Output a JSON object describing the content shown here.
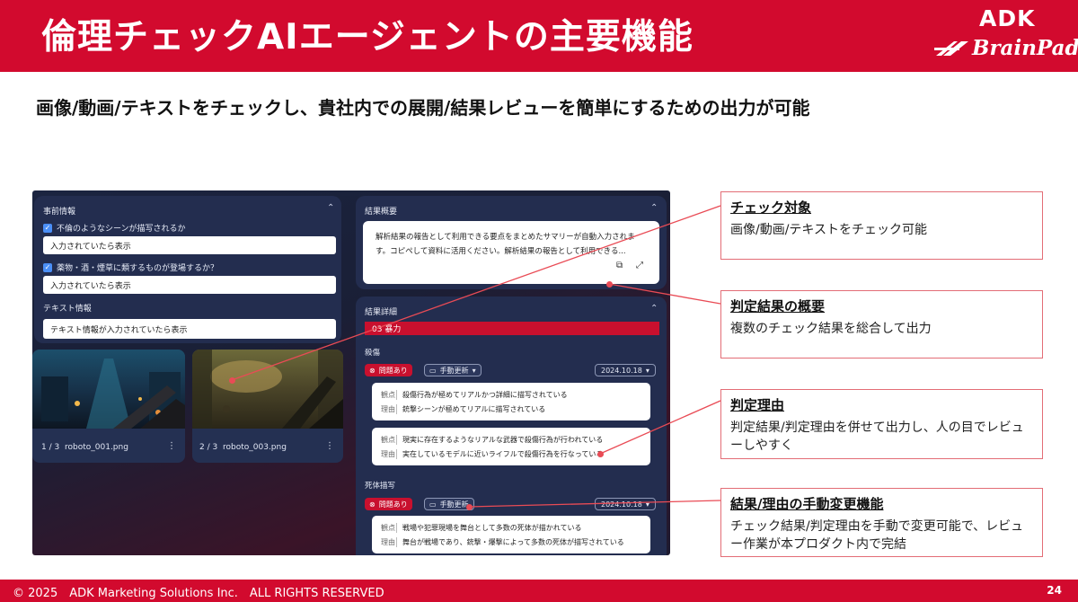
{
  "header": {
    "title": "倫理チェックAIエージェントの主要機能",
    "logo_adk": "ADK",
    "logo_brainpad": "BrainPad"
  },
  "subtitle": "画像/動画/テキストをチェックし、貴社内での展開/結果レビューを簡単にするための出力が可能",
  "app": {
    "prior_info": {
      "title": "事前情報",
      "q1": "不倫のようなシーンが描写されるか",
      "q1_value": "入力されていたら表示",
      "q2": "薬物・酒・煙草に類するものが登場するか？",
      "q2_value": "入力されていたら表示",
      "text_info_label": "テキスト情報",
      "text_info_value": "テキスト情報が入力されていたら表示"
    },
    "thumbnails": [
      {
        "index": "1 / 3",
        "filename": "roboto_001.png"
      },
      {
        "index": "2 / 3",
        "filename": "roboto_003.png"
      }
    ],
    "summary": {
      "title": "結果概要",
      "text": "解析結果の報告として利用できる要点をまとめたサマリーが自動入力されます。コピペして資料に活用ください。解析結果の報告として利用できる..."
    },
    "details": {
      "title": "結果詳細",
      "category": "03 暴力",
      "sections": [
        {
          "label": "殺傷",
          "issue": "問題あり",
          "manual": "手動更新",
          "date": "2024.10.18",
          "cards": [
            {
              "k1": "観点",
              "v1": "殺傷行為が極めてリアルかつ詳細に描写されている",
              "k2": "理由",
              "v2": "銃撃シーンが極めてリアルに描写されている"
            },
            {
              "k1": "観点",
              "v1": "現実に存在するようなリアルな武器で殺傷行為が行われている",
              "k2": "理由",
              "v2": "実在しているモデルに近いライフルで殺傷行為を行なっている"
            }
          ]
        },
        {
          "label": "死体描写",
          "issue": "問題あり",
          "manual": "手動更新",
          "date": "2024.10.18",
          "cards": [
            {
              "k1": "観点",
              "v1": "戦場や犯罪現場を舞台として多数の死体が描かれている",
              "k2": "理由",
              "v2": "舞台が戦場であり、銃撃・爆撃によって多数の死体が描写されている"
            }
          ]
        }
      ]
    }
  },
  "callouts": [
    {
      "title": "チェック対象",
      "body": "画像/動画/テキストをチェック可能"
    },
    {
      "title": "判定結果の概要",
      "body": "複数のチェック結果を総合して出力"
    },
    {
      "title": "判定理由",
      "body": "判定結果/判定理由を併せて出力し、人の目でレビューしやすく"
    },
    {
      "title": "結果/理由の手動変更機能",
      "body": "チェック結果/判定理由を手動で変更可能で、レビュー作業が本プロダクト内で完結"
    }
  ],
  "footer": {
    "copyright": "© 2025　ADK Marketing Solutions Inc.　ALL RIGHTS RESERVED",
    "page": "24"
  },
  "colors": {
    "brand_red": "#d20a2e",
    "callout_border": "#e36d76",
    "pointer": "#e94b55",
    "app_panel": "#232d4f"
  }
}
